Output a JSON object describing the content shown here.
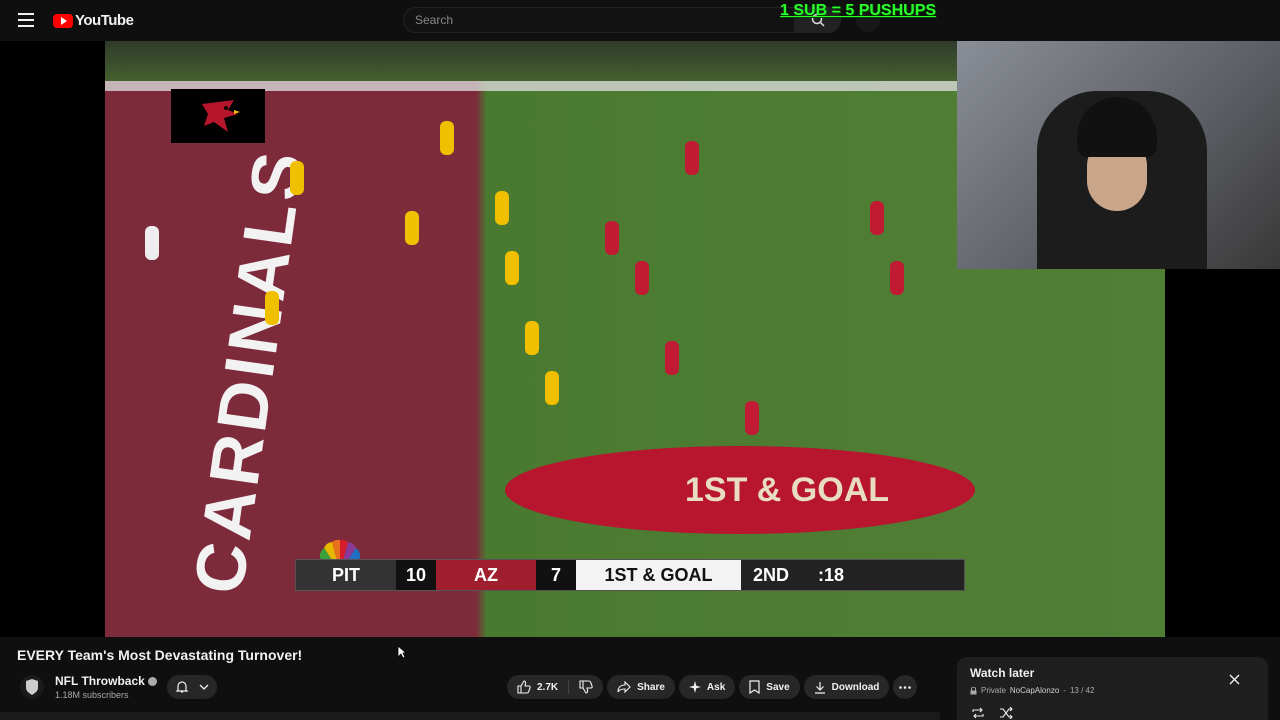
{
  "header": {
    "app_name": "YouTube",
    "search_placeholder": "Search",
    "overlay_text": "1 SUB = 5 PUSHUPS"
  },
  "video": {
    "endzone_text": "CARDINALS",
    "field_text": "1ST & GOAL",
    "scorebug": {
      "team1": "PIT",
      "score1": "10",
      "team2": "AZ",
      "score2": "7",
      "down": "1ST & GOAL",
      "quarter": "2ND",
      "clock": ":18"
    }
  },
  "meta": {
    "title": "EVERY Team's Most Devastating Turnover!",
    "channel_name": "NFL Throwback",
    "subscribers": "1.18M subscribers"
  },
  "actions": {
    "likes": "2.7K",
    "share": "Share",
    "ask": "Ask",
    "save": "Save",
    "download": "Download"
  },
  "playlist": {
    "title": "Watch later",
    "privacy": "Private",
    "owner": "NoCapAlonzo",
    "position": "13 / 42"
  },
  "colors": {
    "brand_red": "#ff0000",
    "overlay_green": "#2bff2b",
    "cardinals_red": "#a01f2f"
  }
}
